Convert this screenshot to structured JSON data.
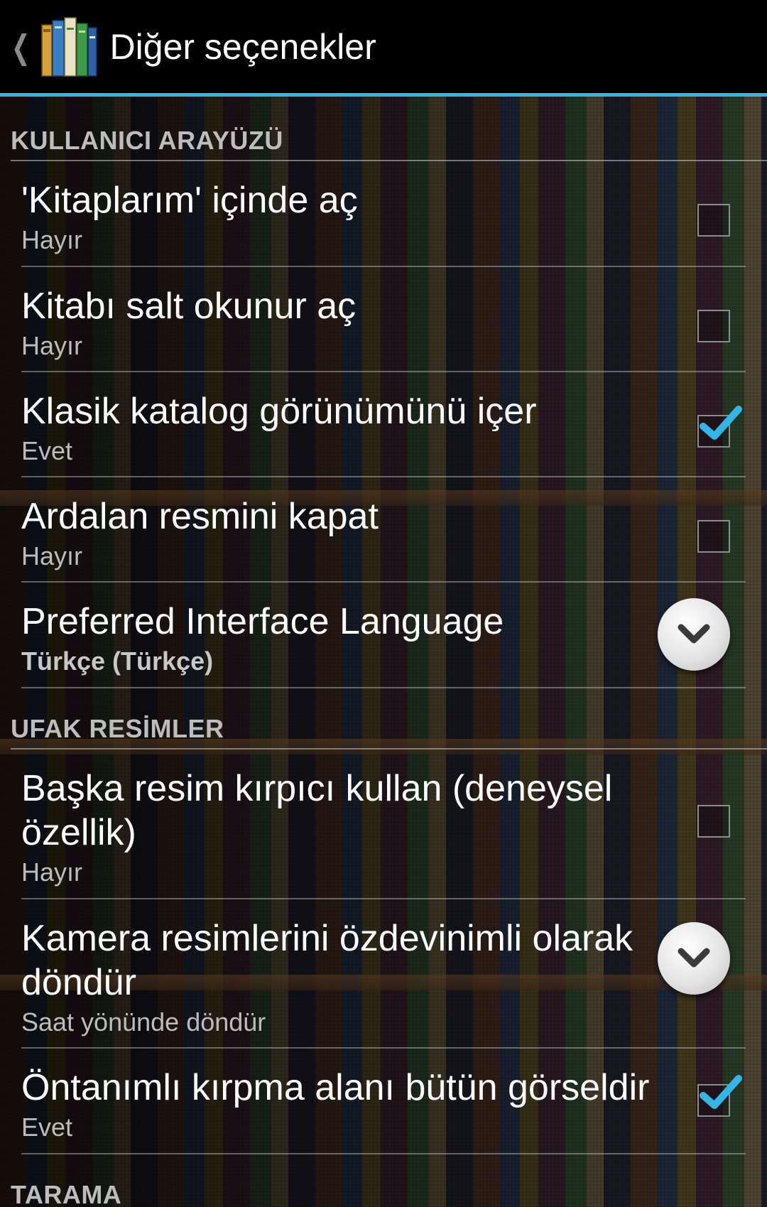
{
  "action_bar": {
    "title": "Diğer seçenekler",
    "up_icon": "chevron-left-icon",
    "app_icon": "books-app-icon",
    "accent_color": "#33b5e5"
  },
  "sections": [
    {
      "title": "KULLANICI ARAYÜZÜ",
      "items": [
        {
          "title": "'Kitaplarım' içinde aç",
          "summary": "Hayır",
          "widget": "checkbox",
          "checked": false
        },
        {
          "title": "Kitabı salt okunur aç",
          "summary": "Hayır",
          "widget": "checkbox",
          "checked": false
        },
        {
          "title": "Klasik katalog görünümünü içer",
          "summary": "Evet",
          "widget": "checkbox",
          "checked": true
        },
        {
          "title": "Ardalan resmini kapat",
          "summary": "Hayır",
          "widget": "checkbox",
          "checked": false
        },
        {
          "title": "Preferred Interface Language",
          "summary": "Türkçe (Türkçe)",
          "widget": "dropdown"
        }
      ]
    },
    {
      "title": "UFAK RESİMLER",
      "items": [
        {
          "title": "Başka resim kırpıcı kullan (deneysel özellik)",
          "summary": "Hayır",
          "widget": "checkbox",
          "checked": false
        },
        {
          "title": "Kamera resimlerini özdevinimli olarak döndür",
          "summary": "Saat yönünde döndür",
          "widget": "dropdown"
        },
        {
          "title": "Öntanımlı kırpma alanı bütün görseldir",
          "summary": "Evet",
          "widget": "checkbox",
          "checked": true
        }
      ]
    },
    {
      "title": "TARAMA",
      "items": []
    }
  ],
  "colors": {
    "check_mark": "#33b5e5",
    "category_text": "#bdbdbd",
    "summary_text": "#bcbcbc"
  }
}
